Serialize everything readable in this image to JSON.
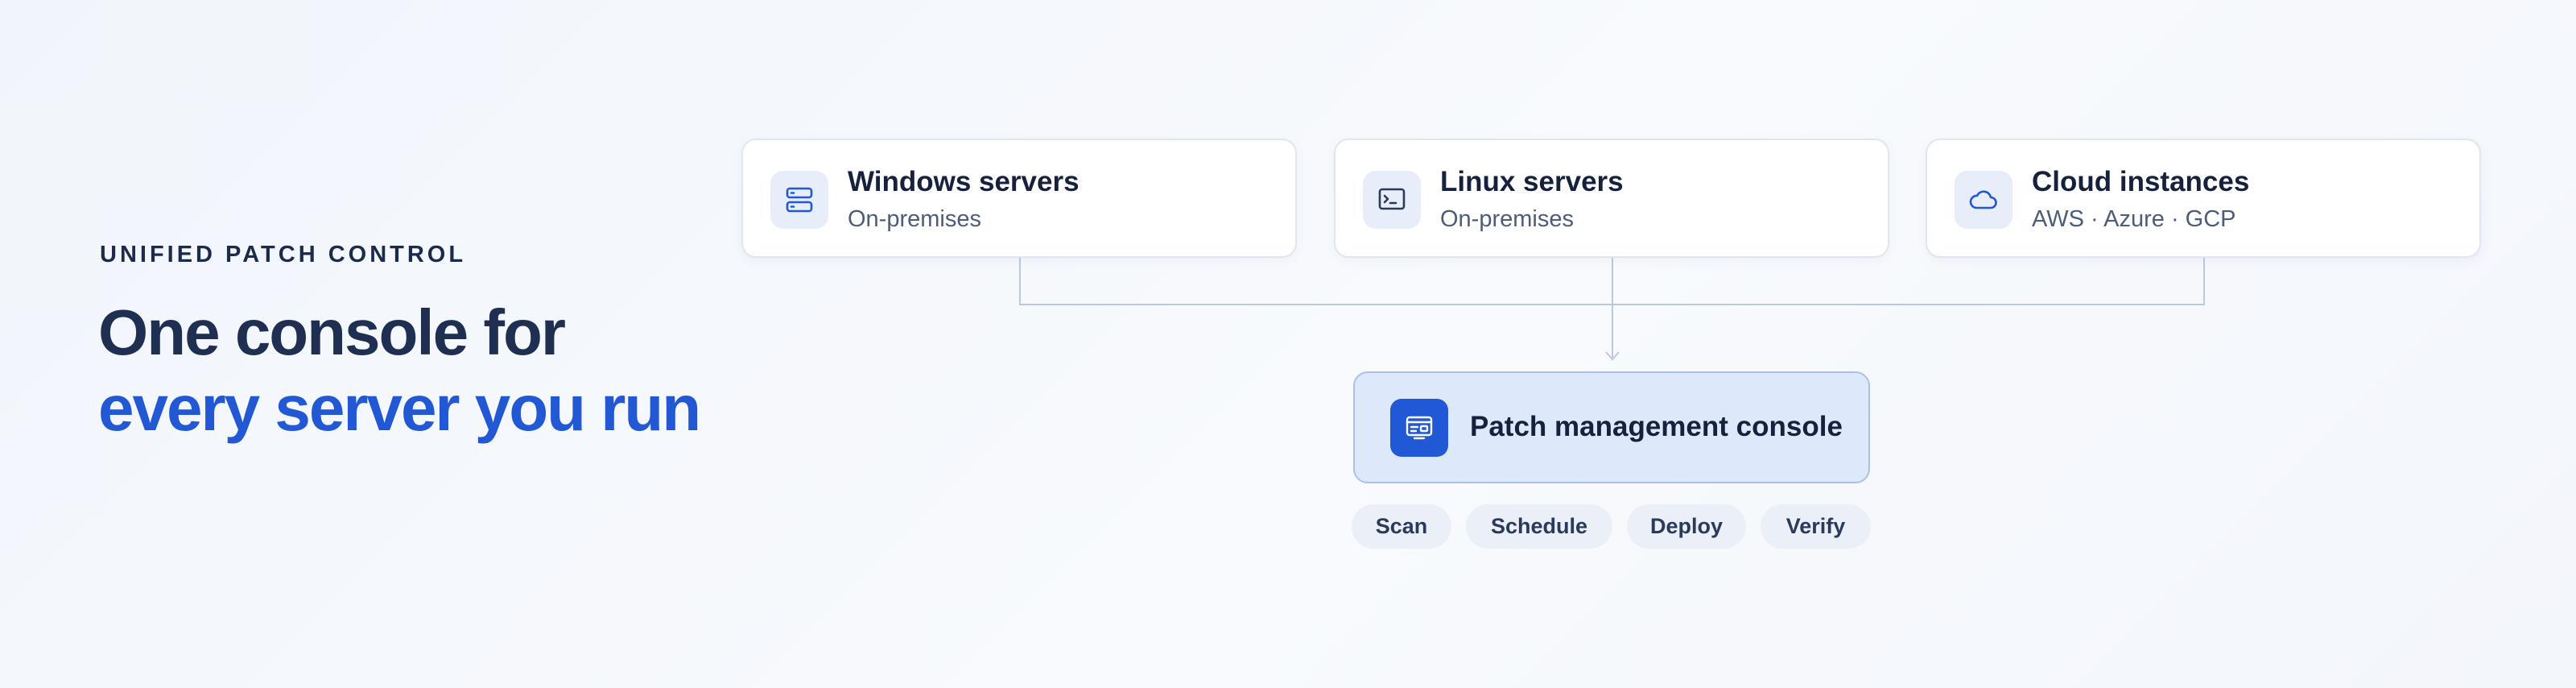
{
  "eyebrow": "UNIFIED PATCH CONTROL",
  "headline": {
    "line1": "One console for",
    "line2": "every server you run"
  },
  "sources": [
    {
      "title": "Windows servers",
      "subtitle": "On-premises",
      "icon": "server-stack-icon"
    },
    {
      "title": "Linux servers",
      "subtitle": "On-premises",
      "icon": "terminal-icon"
    },
    {
      "title": "Cloud instances",
      "subtitle": "AWS · Azure · GCP",
      "icon": "cloud-icon"
    }
  ],
  "console": {
    "title": "Patch management console",
    "icon": "console-icon"
  },
  "steps": [
    "Scan",
    "Schedule",
    "Deploy",
    "Verify"
  ],
  "colors": {
    "accent": "#2258d4",
    "heading": "#1e2f52",
    "console_fill": "#dde8fa",
    "connector": "#b9c9e2"
  }
}
